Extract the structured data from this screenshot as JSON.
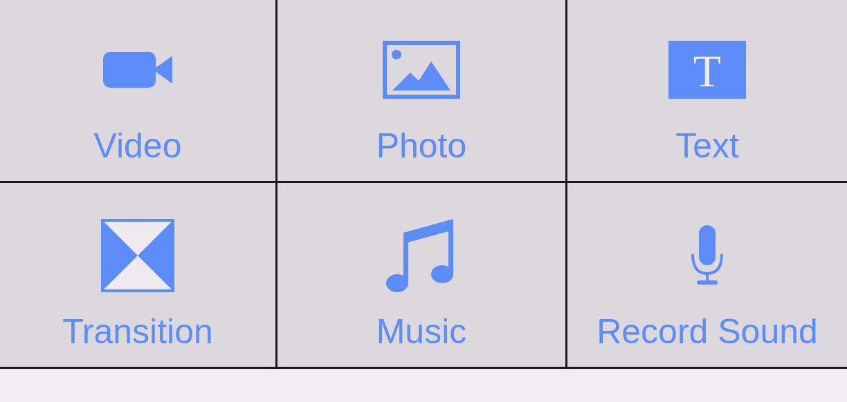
{
  "tiles": [
    {
      "label": "Video",
      "kind": "video"
    },
    {
      "label": "Photo",
      "kind": "photo"
    },
    {
      "label": "Text",
      "kind": "text",
      "glyph": "T"
    },
    {
      "label": "Transition",
      "kind": "transition"
    },
    {
      "label": "Music",
      "kind": "music"
    },
    {
      "label": "Record Sound",
      "kind": "microphone"
    }
  ]
}
